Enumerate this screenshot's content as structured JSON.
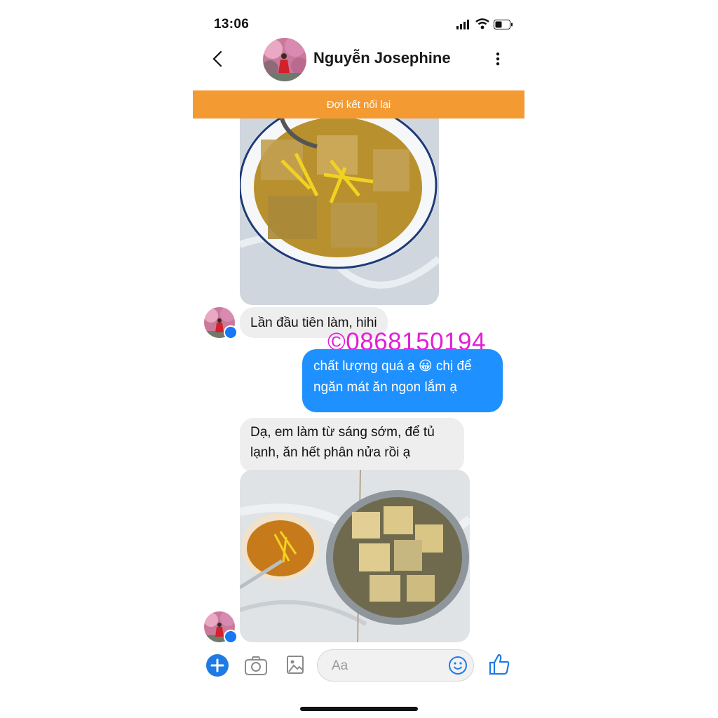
{
  "status_bar": {
    "time": "13:06"
  },
  "header": {
    "contact_name": "Nguyễn Josephine"
  },
  "banner": {
    "text": "Đợi kết nối lại"
  },
  "watermark": "©0868150194",
  "messages": [
    {
      "type": "image",
      "from": "contact",
      "subject": "ginger jelly dessert in white bowl"
    },
    {
      "type": "text",
      "from": "contact",
      "text": "Lần đầu tiên làm, hihi"
    },
    {
      "type": "text",
      "from": "me",
      "line1": "chất lượng quá ạ 😀 chị để",
      "line2": "ngăn mát ăn ngon lắm ạ"
    },
    {
      "type": "text",
      "from": "contact",
      "line1": "Dạ, em làm từ sáng sớm, để tủ",
      "line2": "lạnh, ăn hết phân nửa rồi ạ"
    },
    {
      "type": "image",
      "from": "contact",
      "subject": "jelly in steel bowl with syrup and ginger"
    }
  ],
  "composer": {
    "placeholder": "Aa"
  },
  "colors": {
    "accent": "#1e90ff",
    "banner": "#f39a32",
    "watermark": "#e21fd6"
  },
  "icons": [
    "back-icon",
    "more-icon",
    "plus-icon",
    "camera-icon",
    "gallery-icon",
    "emoji-icon",
    "like-icon"
  ]
}
